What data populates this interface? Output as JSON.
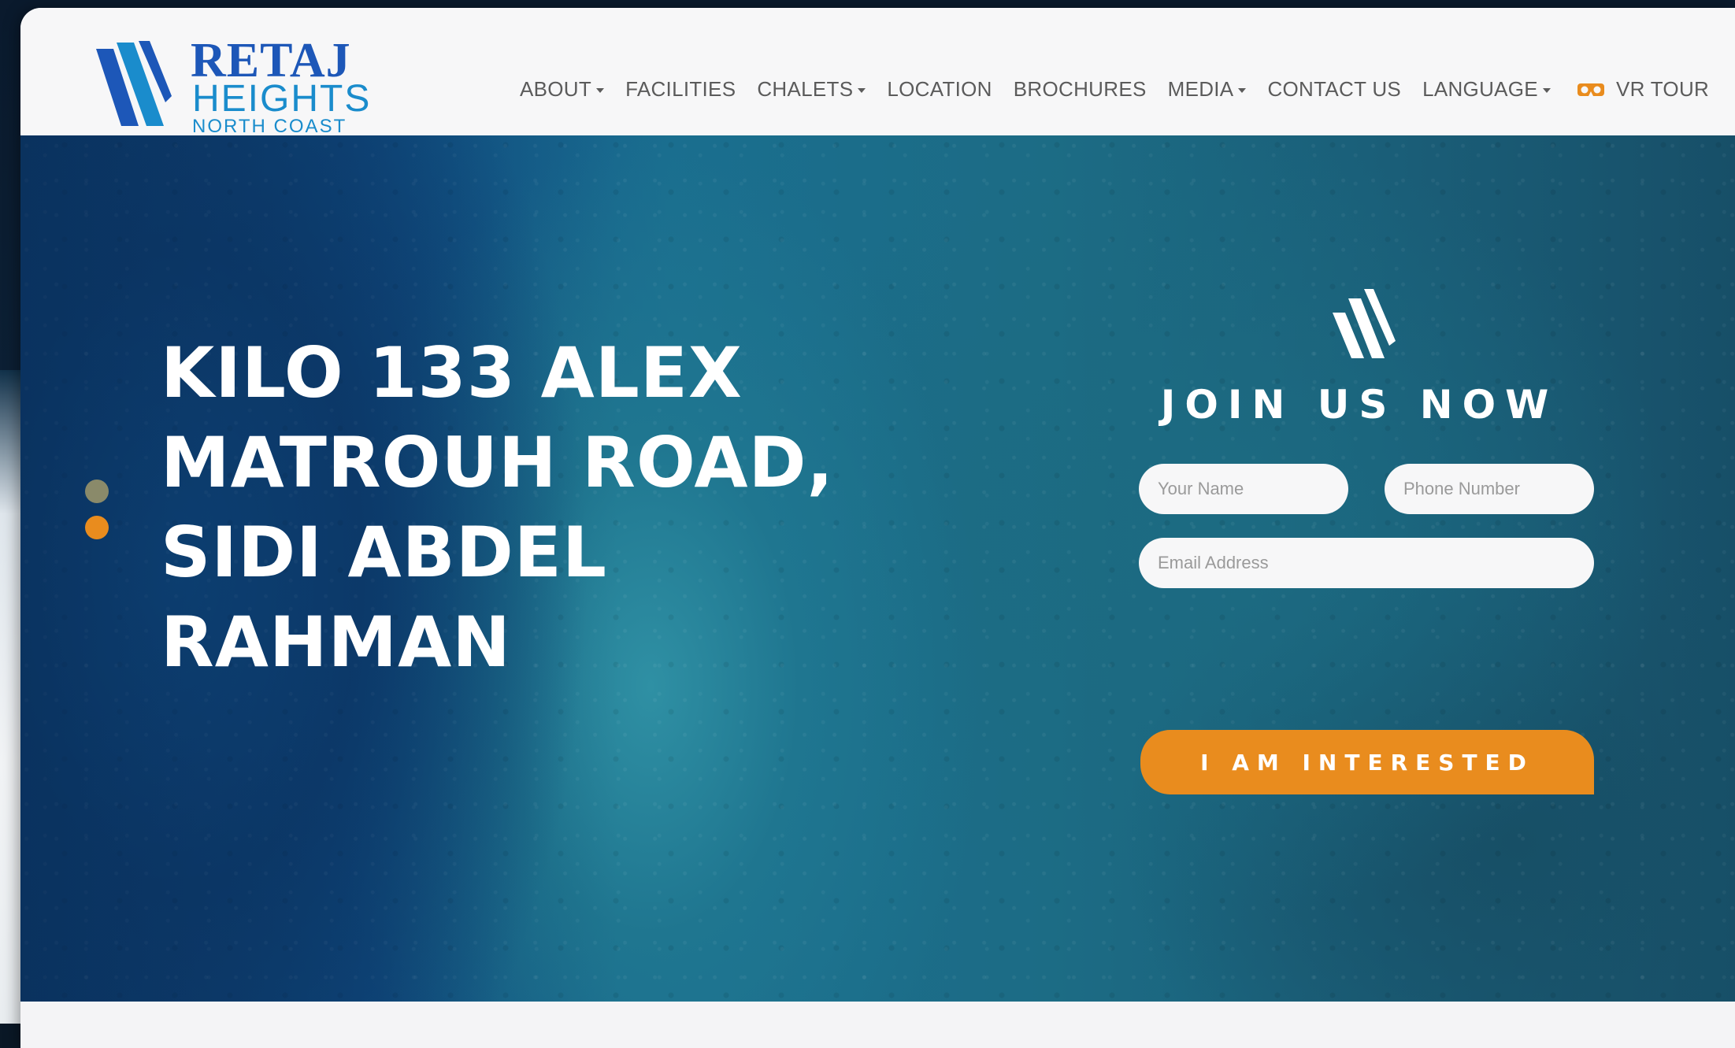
{
  "logo": {
    "word": "RETAJ",
    "line2": "HEIGHTS",
    "line3": "NORTH COAST"
  },
  "nav": {
    "items": [
      {
        "label": "ABOUT",
        "dropdown": true
      },
      {
        "label": "FACILITIES",
        "dropdown": false
      },
      {
        "label": "CHALETS",
        "dropdown": true
      },
      {
        "label": "LOCATION",
        "dropdown": false
      },
      {
        "label": "BROCHURES",
        "dropdown": false
      },
      {
        "label": "MEDIA",
        "dropdown": true
      },
      {
        "label": "CONTACT US",
        "dropdown": false
      },
      {
        "label": "LANGUAGE",
        "dropdown": true
      }
    ],
    "vr_tour": "VR TOUR",
    "vr_icon": "vr-headset-icon"
  },
  "hero": {
    "title_lines": [
      "KILO 133 ALEX",
      "MATROUH ROAD,",
      "SIDI ABDEL",
      "RAHMAN"
    ],
    "dots": [
      {
        "color": "#8a8a6a",
        "active": false
      },
      {
        "color": "#e98c1e",
        "active": true
      }
    ]
  },
  "form": {
    "heading": "JOIN US NOW",
    "name_placeholder": "Your Name",
    "phone_placeholder": "Phone Number",
    "email_placeholder": "Email Address",
    "submit_label": "I AM INTERESTED"
  },
  "colors": {
    "brand_blue": "#1d57b8",
    "brand_light_blue": "#1a8ccc",
    "accent_orange": "#e98c1e",
    "nav_text": "#5b5b5b"
  }
}
